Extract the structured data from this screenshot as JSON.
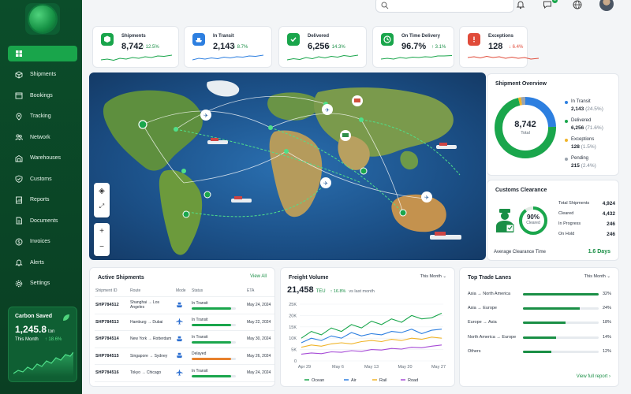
{
  "nav": {
    "items": [
      {
        "label": "",
        "icon": "grid-icon"
      },
      {
        "label": "Shipments",
        "icon": "box-icon"
      },
      {
        "label": "Bookings",
        "icon": "calendar-icon"
      },
      {
        "label": "Tracking",
        "icon": "pin-icon"
      },
      {
        "label": "Network",
        "icon": "network-icon"
      },
      {
        "label": "Warehouses",
        "icon": "warehouse-icon"
      },
      {
        "label": "Customs",
        "icon": "shield-icon"
      },
      {
        "label": "Reports",
        "icon": "report-icon"
      },
      {
        "label": "Documents",
        "icon": "document-icon"
      },
      {
        "label": "Invoices",
        "icon": "dollar-icon"
      },
      {
        "label": "Alerts",
        "icon": "bell-icon"
      },
      {
        "label": "Settings",
        "icon": "gear-icon"
      }
    ]
  },
  "carbon": {
    "title": "Carbon Saved",
    "value": "1,245.8",
    "unit": "ton",
    "period": "This Month",
    "change": "18.6%"
  },
  "header": {
    "notifications_badge": "5"
  },
  "kpis": [
    {
      "label": "Shipments",
      "value": "8,742",
      "change": "12.5%",
      "dir": "up",
      "color": "#19a54b",
      "icon": "cube-icon"
    },
    {
      "label": "In Transit",
      "value": "2,143",
      "change": "8.7%",
      "dir": "up",
      "color": "#2d7fe0",
      "icon": "ship-icon"
    },
    {
      "label": "Delivered",
      "value": "6,256",
      "change": "14.3%",
      "dir": "up",
      "color": "#19a54b",
      "icon": "check-icon"
    },
    {
      "label": "On Time Delivery",
      "value": "96.7%",
      "change": "3.1%",
      "dir": "up",
      "color": "#19a54b",
      "icon": "clock-icon"
    },
    {
      "label": "Exceptions",
      "value": "128",
      "change": "6.4%",
      "dir": "down",
      "color": "#e04b3a",
      "icon": "alert-icon"
    }
  ],
  "overview": {
    "title": "Shipment Overview",
    "total": "8,742",
    "total_label": "Total",
    "segments": [
      {
        "label": "In Transit",
        "value": "2,143",
        "pct": "(24.5%)",
        "share": 24.5,
        "color": "#2d7fe0"
      },
      {
        "label": "Delivered",
        "value": "6,256",
        "pct": "(71.6%)",
        "share": 71.6,
        "color": "#1aa64c"
      },
      {
        "label": "Exceptions",
        "value": "128",
        "pct": "(1.5%)",
        "share": 1.5,
        "color": "#f0b429"
      },
      {
        "label": "Pending",
        "value": "215",
        "pct": "(2.4%)",
        "share": 2.4,
        "color": "#9aa3ad"
      }
    ]
  },
  "customs": {
    "title": "Customs Clearance",
    "percent": "90%",
    "percent_label": "Cleared",
    "share": 90,
    "rows": [
      {
        "label": "Total Shipments",
        "value": "4,924"
      },
      {
        "label": "Cleared",
        "value": "4,432"
      },
      {
        "label": "In Progress",
        "value": "246"
      },
      {
        "label": "On Hold",
        "value": "246"
      }
    ],
    "avg_label": "Average Clearance Time",
    "avg_value": "1.6 Days"
  },
  "active": {
    "title": "Active Shipments",
    "view_all": "View All",
    "columns": [
      "Shipment ID",
      "Route",
      "Mode",
      "Status",
      "ETA"
    ],
    "rows": [
      {
        "id": "SHP784512",
        "route": "Shanghai → Los Angeles",
        "mode": "ship-icon",
        "status": "In Transit",
        "progress": 0.9,
        "color": "#1aa64c",
        "eta": "May 24, 2024"
      },
      {
        "id": "SHP784513",
        "route": "Hamburg → Dubai",
        "mode": "plane-icon",
        "status": "In Transit",
        "progress": 0.9,
        "color": "#1aa64c",
        "eta": "May 22, 2024"
      },
      {
        "id": "SHP784514",
        "route": "New York → Rotterdam",
        "mode": "ship-icon",
        "status": "In Transit",
        "progress": 0.9,
        "color": "#1aa64c",
        "eta": "May 30, 2024"
      },
      {
        "id": "SHP784515",
        "route": "Singapore → Sydney",
        "mode": "ship-icon",
        "status": "Delayed",
        "progress": 0.9,
        "color": "#e8812c",
        "eta": "May 26, 2024"
      },
      {
        "id": "SHP784516",
        "route": "Tokyo → Chicago",
        "mode": "plane-icon",
        "status": "In Transit",
        "progress": 0.9,
        "color": "#1aa64c",
        "eta": "May 24, 2024"
      }
    ]
  },
  "freight": {
    "title": "Freight Volume",
    "period": "This Month",
    "value": "21,458",
    "unit": "TEU",
    "change": "16.8%",
    "change_note": "vs last month"
  },
  "chart_data": {
    "type": "line",
    "x": [
      "Apr 29",
      "May 6",
      "May 13",
      "May 20",
      "May 27"
    ],
    "ylim": [
      0,
      25000
    ],
    "yticks": [
      "0",
      "5K",
      "10K",
      "15K",
      "20K",
      "25K"
    ],
    "series": [
      {
        "name": "Ocean",
        "color": "#1aa64c",
        "values": [
          10000,
          13000,
          11500,
          14500,
          13000,
          16000,
          14500,
          17500,
          16000,
          18500,
          17000,
          20000,
          18500,
          19000,
          21000
        ]
      },
      {
        "name": "Air",
        "color": "#2d7fe0",
        "values": [
          8000,
          10000,
          9000,
          11000,
          10000,
          12500,
          11000,
          12000,
          11500,
          13000,
          12500,
          14000,
          12000,
          13500,
          14000
        ]
      },
      {
        "name": "Rail",
        "color": "#f0b429",
        "values": [
          6000,
          7000,
          6500,
          7500,
          8000,
          7500,
          8500,
          9000,
          8500,
          9500,
          9000,
          10000,
          9500,
          10500,
          10000
        ]
      },
      {
        "name": "Road",
        "color": "#a64bd6",
        "values": [
          3000,
          3500,
          3200,
          4000,
          3800,
          4500,
          4200,
          5000,
          4800,
          5500,
          5200,
          6000,
          5800,
          6500,
          7000
        ]
      }
    ]
  },
  "lanes": {
    "title": "Top Trade Lanes",
    "period": "This Month",
    "rows": [
      {
        "name": "Asia → North America",
        "share": 32,
        "pct": "32%"
      },
      {
        "name": "Asia → Europe",
        "share": 24,
        "pct": "24%"
      },
      {
        "name": "Europe → Asia",
        "share": 18,
        "pct": "18%"
      },
      {
        "name": "North America → Europe",
        "share": 14,
        "pct": "14%"
      },
      {
        "name": "Others",
        "share": 12,
        "pct": "12%"
      }
    ],
    "link": "View full report"
  }
}
